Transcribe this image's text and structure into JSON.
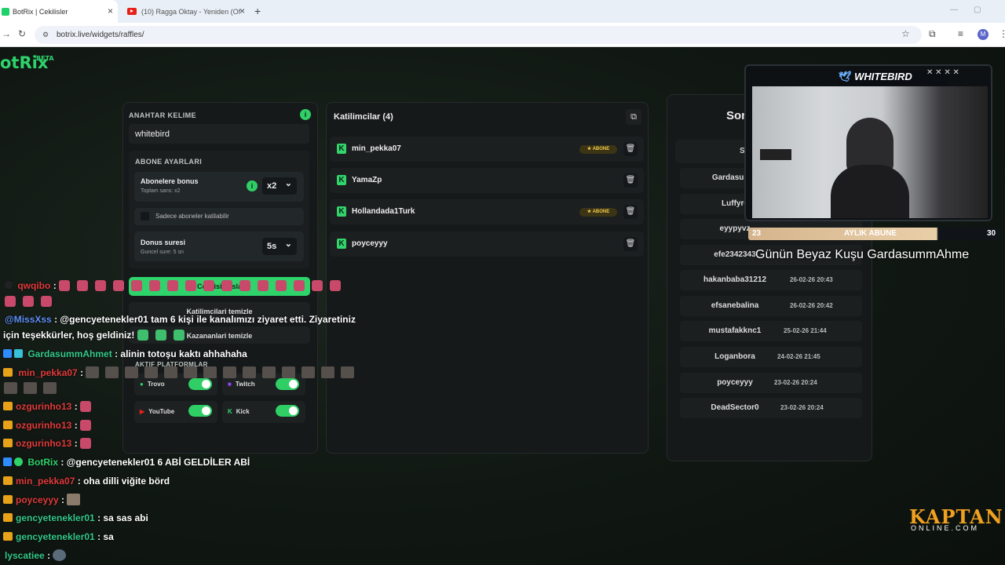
{
  "browser": {
    "tabs": [
      {
        "title": "BotRix | Cekilisler"
      },
      {
        "title": "(10) Ragga Oktay - Yeniden (Of"
      }
    ],
    "url": "botrix.live/widgets/raffles/",
    "profile_initial": "M"
  },
  "app": {
    "logo": "otRix",
    "logo_badge": "BETA"
  },
  "settings": {
    "keyword_label": "ANAHTAR KELIME",
    "keyword_value": "whitebird",
    "sub_settings_label": "ABONE AYARLARI",
    "sub_bonus_title": "Abonelere bonus",
    "sub_bonus_sub": "Toplam sans: x2",
    "sub_bonus_value": "x2",
    "only_subs_label": "Sadece aboneler katilabilir",
    "spin_title": "Donus suresi",
    "spin_sub": "Guncel sure: 5 sn",
    "spin_value": "5s",
    "start_btn": "Cekilisi basla",
    "clear_participants": "Katilimcilari temizle",
    "clear_winners": "Kazananlari temizle",
    "platforms_label": "AKTIF PLATFORMLAR",
    "platforms": [
      {
        "name": "Trovo"
      },
      {
        "name": "Twitch"
      },
      {
        "name": "YouTube"
      },
      {
        "name": "Kick"
      }
    ]
  },
  "participants": {
    "title": "Katilimcilar (4)",
    "badge_label": "ABONE",
    "items": [
      {
        "name": "min_pekka07",
        "sub": true
      },
      {
        "name": "YamaZp",
        "sub": false
      },
      {
        "name": "Hollandada1Turk",
        "sub": true
      },
      {
        "name": "poyceyyy",
        "sub": false
      }
    ]
  },
  "winners": {
    "title": "Son",
    "subhead": "S",
    "items": [
      {
        "name": "Gardasumm",
        "date": ""
      },
      {
        "name": "Luffyre",
        "date": ""
      },
      {
        "name": "eyypyvz",
        "date": ""
      },
      {
        "name": "efe2342343",
        "date": ""
      },
      {
        "name": "hakanbaba31212",
        "date": "26-02-26 20:43"
      },
      {
        "name": "efsanebalina",
        "date": "26-02-26 20:42"
      },
      {
        "name": "mustafakknc1",
        "date": "25-02-26 21:44"
      },
      {
        "name": "Loganbora",
        "date": "24-02-26 21:45"
      },
      {
        "name": "poyceyyy",
        "date": "23-02-26 20:24"
      },
      {
        "name": "DeadSector0",
        "date": "23-02-26 20:24"
      }
    ]
  },
  "overlay": {
    "cam_title": "WHITEBIRD",
    "sub_goal_left": "23",
    "sub_goal_label": "AYLIK ABUNE",
    "sub_goal_right": "30",
    "ticker": "Günün Beyaz Kuşu GardasummAhme"
  },
  "chat": [
    {
      "user": "qwqibo",
      "text": "",
      "color": "#e03b3b"
    },
    {
      "user": "@MissXss",
      "text": ": @gencyetenekler01 tam 6 kişi ile kanalımızı ziyaret etti. Ziyaretiniz",
      "color": "#5d8ef5"
    },
    {
      "user": "",
      "text": "için teşekkürler, hoş geldiniz!",
      "color": "#ffffff"
    },
    {
      "user": "GardasummAhmet",
      "text": ": alinin totoşu kaktı ahhahaha",
      "color": "#34c98a"
    },
    {
      "user": "min_pekka07",
      "text": ":",
      "color": "#e03b3b"
    },
    {
      "user": "ozgurinho13",
      "text": ":",
      "color": "#e03b3b"
    },
    {
      "user": "ozgurinho13",
      "text": ":",
      "color": "#e03b3b"
    },
    {
      "user": "ozgurinho13",
      "text": ":",
      "color": "#e03b3b"
    },
    {
      "user": "BotRix",
      "text": ": @gencyetenekler01 6 ABİ GELDİLER ABİ",
      "color": "#2fd36b"
    },
    {
      "user": "min_pekka07",
      "text": ": oha dilli viğite börd",
      "color": "#e03b3b"
    },
    {
      "user": "poyceyyy",
      "text": ":",
      "color": "#e03b3b"
    },
    {
      "user": "gencyetenekler01",
      "text": ": sa sas abi",
      "color": "#34c98a"
    },
    {
      "user": "gencyetenekler01",
      "text": ": sa",
      "color": "#34c98a"
    },
    {
      "user": "lyscatiee",
      "text": ":",
      "color": "#34c98a"
    }
  ],
  "brand": {
    "kaptan": "KAPTAN",
    "online": "ONLINE.COM"
  },
  "colors": {
    "accent": "#2fd36b",
    "badge": "#f2c94c",
    "sub_bar": "#e9cfa8"
  }
}
